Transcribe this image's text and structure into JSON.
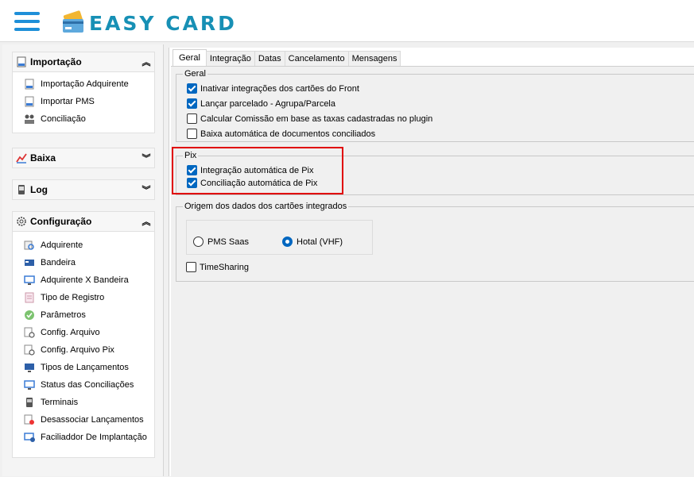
{
  "app": {
    "logo_text": "EASY CARD"
  },
  "sidebar": {
    "importacao": {
      "title": "Importação",
      "items": [
        {
          "label": "Importação Adquirente",
          "icon": "document-icon"
        },
        {
          "label": "Importar PMS",
          "icon": "document-icon"
        },
        {
          "label": "Conciliação",
          "icon": "people-icon"
        }
      ]
    },
    "baixa": {
      "title": "Baixa"
    },
    "log": {
      "title": "Log"
    },
    "configuracao": {
      "title": "Configuração",
      "items": [
        {
          "label": "Adquirente"
        },
        {
          "label": "Bandeira"
        },
        {
          "label": "Adquirente X Bandeira"
        },
        {
          "label": "Tipo de Registro"
        },
        {
          "label": "Parâmetros"
        },
        {
          "label": "Config. Arquivo"
        },
        {
          "label": "Config. Arquivo Pix"
        },
        {
          "label": "Tipos de Lançamentos"
        },
        {
          "label": "Status das Conciliações"
        },
        {
          "label": "Terminais"
        },
        {
          "label": "Desassociar Lançamentos"
        },
        {
          "label": "Faciliaddor De Implantação"
        }
      ]
    }
  },
  "tabs": [
    "Geral",
    "Integração",
    "Datas",
    "Cancelamento",
    "Mensagens"
  ],
  "geral_group": {
    "title": "Geral",
    "options": [
      {
        "label": "Inativar integrações dos cartões do Front",
        "checked": true
      },
      {
        "label": "Lançar parcelado - Agrupa/Parcela",
        "checked": true
      },
      {
        "label": "Calcular Comissão em base as taxas cadastradas no plugin",
        "checked": false
      },
      {
        "label": "Baixa automática de documentos conciliados",
        "checked": false
      }
    ]
  },
  "pix_group": {
    "title": "Pix",
    "options": [
      {
        "label": "Integração automática de Pix",
        "checked": true
      },
      {
        "label": "Conciliação automática de Pix",
        "checked": true
      }
    ]
  },
  "origem_group": {
    "title": "Origem dos dados dos cartões integrados",
    "radio_options": [
      {
        "label": "PMS Saas",
        "selected": false
      },
      {
        "label": "Hotal (VHF)",
        "selected": true
      }
    ],
    "timesharing": {
      "label": "TimeSharing",
      "checked": false
    }
  },
  "colors": {
    "accent": "#1e8fd8",
    "logo": "#1790b5",
    "highlight": "#e00000",
    "check": "#0067c0"
  }
}
